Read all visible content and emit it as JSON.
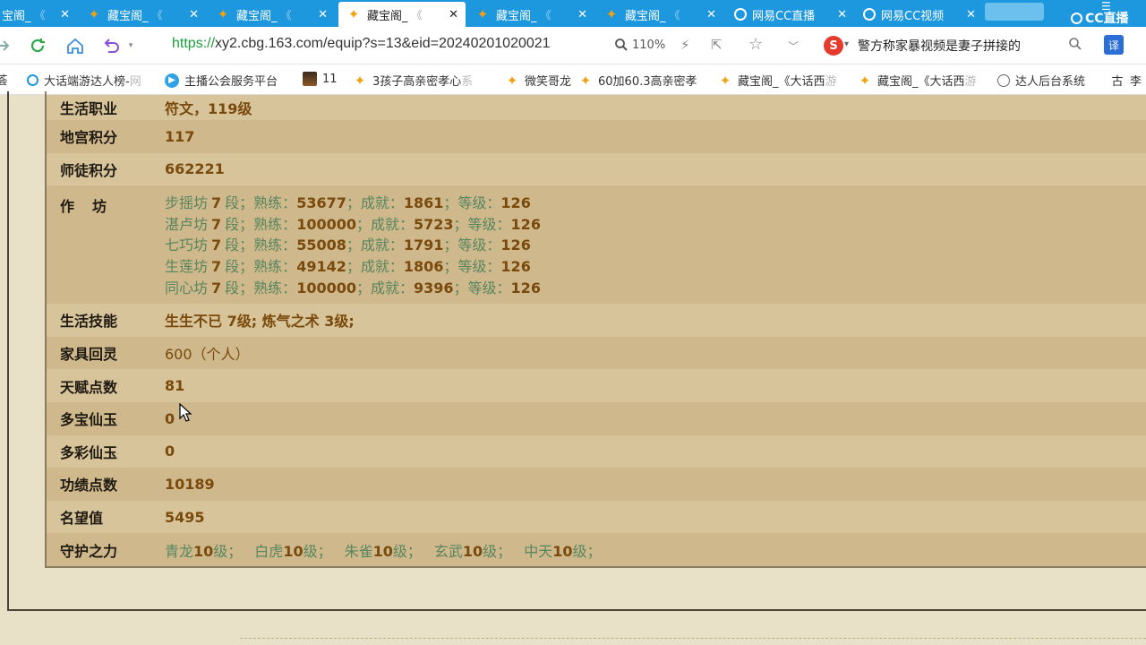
{
  "tabs": [
    {
      "title": "宝阁_",
      "fade": "《",
      "active": false
    },
    {
      "title": "藏宝阁_",
      "fade": "《",
      "active": false
    },
    {
      "title": "藏宝阁_",
      "fade": "《",
      "active": false
    },
    {
      "title": "藏宝阁_",
      "fade": "《",
      "active": true
    },
    {
      "title": "藏宝阁_",
      "fade": "《",
      "active": false
    },
    {
      "title": "藏宝阁_",
      "fade": "《",
      "active": false
    },
    {
      "title": "网易CC直播",
      "fade": "",
      "active": false
    },
    {
      "title": "网易CC视频",
      "fade": "",
      "active": false
    }
  ],
  "tab_close_glyph": "✕",
  "brand": {
    "logo_text": "CC直播",
    "menu_glyph": "☰"
  },
  "address": {
    "scheme": "https://",
    "rest": "xy2.cbg.163.com/equip?s=13&eid=20240201020021",
    "zoom": "110%"
  },
  "search": {
    "engine_glyph": "S",
    "caret": "▾",
    "text": "警方称家暴视频是妻子拼接的"
  },
  "translate_glyph": "译",
  "bookmarks": [
    {
      "icon": "text",
      "glyph": "荟",
      "label": "",
      "faded": ""
    },
    {
      "icon": "cc",
      "glyph": "",
      "label": "大话端游达人榜-",
      "faded": "网"
    },
    {
      "icon": "live",
      "glyph": "▶",
      "label": "主播公会服务平台",
      "faded": ""
    },
    {
      "icon": "photo",
      "glyph": "",
      "label": "11",
      "faded": ""
    },
    {
      "icon": "gold",
      "glyph": "✦",
      "label": "3孩子高亲密孝心",
      "faded": "系"
    },
    {
      "icon": "gold",
      "glyph": "✦",
      "label": "微笑哥龙",
      "faded": ""
    },
    {
      "icon": "gold",
      "glyph": "✦",
      "label": "60加60.3高亲密孝",
      "faded": ""
    },
    {
      "icon": "gold",
      "glyph": "✦",
      "label": "藏宝阁_《大话西",
      "faded": "游"
    },
    {
      "icon": "gold",
      "glyph": "✦",
      "label": "藏宝阁_《大话西",
      "faded": "游"
    },
    {
      "icon": "globe",
      "glyph": "",
      "label": "达人后台系统",
      "faded": ""
    },
    {
      "icon": "text",
      "glyph": "古",
      "label": "李",
      "faded": ""
    }
  ],
  "attributes": {
    "life_job": {
      "label": "生活职业",
      "value": "符文，119级"
    },
    "dungeon_points": {
      "label": "地宫积分",
      "value": "117"
    },
    "mentor_points": {
      "label": "师徒积分",
      "value": "662221"
    },
    "workshop": {
      "label": "作　坊",
      "items": [
        {
          "name": "步摇坊",
          "rank": "7",
          "practice": "53677",
          "achievement": "1861",
          "level": "126"
        },
        {
          "name": "湛卢坊",
          "rank": "7",
          "practice": "100000",
          "achievement": "5723",
          "level": "126"
        },
        {
          "name": "七巧坊",
          "rank": "7",
          "practice": "55008",
          "achievement": "1791",
          "level": "126"
        },
        {
          "name": "生莲坊",
          "rank": "7",
          "practice": "49142",
          "achievement": "1806",
          "level": "126"
        },
        {
          "name": "同心坊",
          "rank": "7",
          "practice": "100000",
          "achievement": "9396",
          "level": "126"
        }
      ],
      "seg_rank": "段；",
      "seg_practice": "熟练：",
      "seg_achievement": "；成就：",
      "seg_level": "；等级："
    },
    "life_skills": {
      "label": "生活技能",
      "value": "生生不已 7级; 炼气之术 3级;"
    },
    "furniture": {
      "label": "家具回灵",
      "value": "600（个人）"
    },
    "talent": {
      "label": "天赋点数",
      "value": "81"
    },
    "duobao": {
      "label": "多宝仙玉",
      "value": "0"
    },
    "duocai": {
      "label": "多彩仙玉",
      "value": "0"
    },
    "merit": {
      "label": "功绩点数",
      "value": "10189"
    },
    "fame": {
      "label": "名望值",
      "value": "5495"
    },
    "guardian": {
      "label": "守护之力",
      "items": [
        {
          "name": "青龙",
          "level": "10",
          "unit": "级；"
        },
        {
          "name": "白虎",
          "level": "10",
          "unit": "级；"
        },
        {
          "name": "朱雀",
          "level": "10",
          "unit": "级；"
        },
        {
          "name": "玄武",
          "level": "10",
          "unit": "级；"
        },
        {
          "name": "中天",
          "level": "10",
          "unit": "级；"
        }
      ]
    }
  }
}
